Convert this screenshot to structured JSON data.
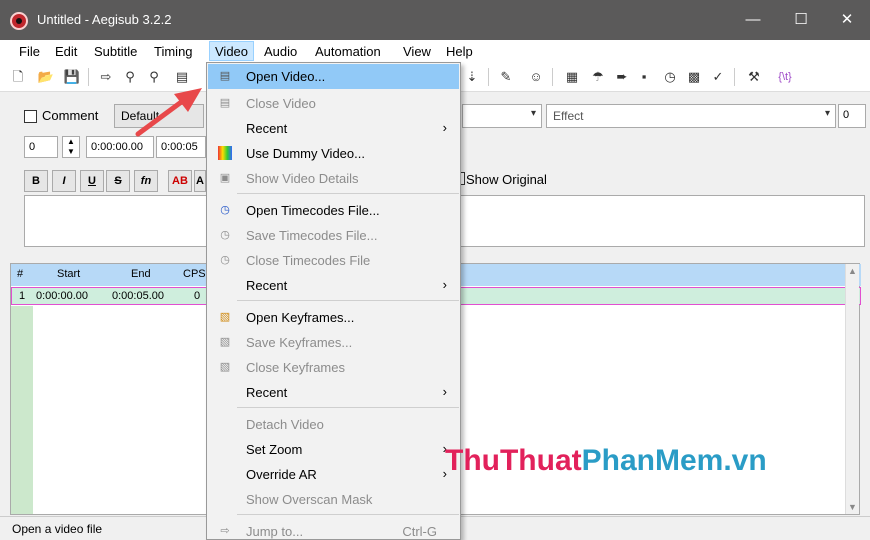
{
  "window": {
    "title": "Untitled - Aegisub 3.2.2",
    "minimize": "—",
    "maximize": "☐",
    "close": "✕"
  },
  "menubar": [
    "File",
    "Edit",
    "Subtitle",
    "Timing",
    "Video",
    "Audio",
    "Automation",
    "View",
    "Help"
  ],
  "edit_panel": {
    "comment_label": "Comment",
    "style_value": "Default",
    "effect_value": "Effect",
    "margin_value": "0",
    "layer_value": "0",
    "start_time": "0:00:00.00",
    "end_time": "0:00:05",
    "show_original_label": "Show Original",
    "format_buttons": [
      "B",
      "I",
      "U",
      "S",
      "fn",
      "AB",
      "A"
    ]
  },
  "grid": {
    "headers": [
      "#",
      "Start",
      "End",
      "CPS"
    ],
    "rows": [
      {
        "num": "1",
        "start": "0:00:00.00",
        "end": "0:00:05.00",
        "cps": "0"
      }
    ]
  },
  "status": {
    "text": "Open a video file"
  },
  "video_menu": {
    "items": [
      {
        "label": "Open Video...",
        "icon": "open-video-icon",
        "enabled": true,
        "highlighted": true
      },
      {
        "label": "Close Video",
        "icon": "close-video-icon",
        "enabled": false
      },
      {
        "label": "Recent",
        "submenu": true,
        "enabled": true
      },
      {
        "label": "Use Dummy Video...",
        "icon": "dummy-video-icon",
        "enabled": true
      },
      {
        "label": "Show Video Details",
        "icon": "video-details-icon",
        "enabled": false
      },
      {
        "label": "Open Timecodes File...",
        "icon": "open-timecodes-icon",
        "enabled": true
      },
      {
        "label": "Save Timecodes File...",
        "icon": "save-timecodes-icon",
        "enabled": false
      },
      {
        "label": "Close Timecodes File",
        "icon": "close-timecodes-icon",
        "enabled": false
      },
      {
        "label": "Recent",
        "submenu": true,
        "enabled": true
      },
      {
        "label": "Open Keyframes...",
        "icon": "open-keyframes-icon",
        "enabled": true
      },
      {
        "label": "Save Keyframes...",
        "icon": "save-keyframes-icon",
        "enabled": false
      },
      {
        "label": "Close Keyframes",
        "icon": "close-keyframes-icon",
        "enabled": false
      },
      {
        "label": "Recent",
        "submenu": true,
        "enabled": true
      },
      {
        "label": "Detach Video",
        "enabled": false
      },
      {
        "label": "Set Zoom",
        "submenu": true,
        "enabled": true
      },
      {
        "label": "Override AR",
        "submenu": true,
        "enabled": true
      },
      {
        "label": "Show Overscan Mask",
        "enabled": false
      },
      {
        "label": "Jump to...",
        "icon": "jump-icon",
        "enabled": false,
        "accelerator": "Ctrl-G"
      }
    ],
    "submenu_arrow": "›"
  },
  "watermark": {
    "part1": "ThuThuat",
    "part2": "PhanMem.vn"
  },
  "colors": {
    "titlebar": "#5b5a5a",
    "highlight": "#91c9f7",
    "grid_header": "#b7d9f7",
    "grid_row": "#cfeedd",
    "watermark_pink": "#e2215b",
    "watermark_blue": "#2a9cc6",
    "arrow": "#e8484a"
  }
}
